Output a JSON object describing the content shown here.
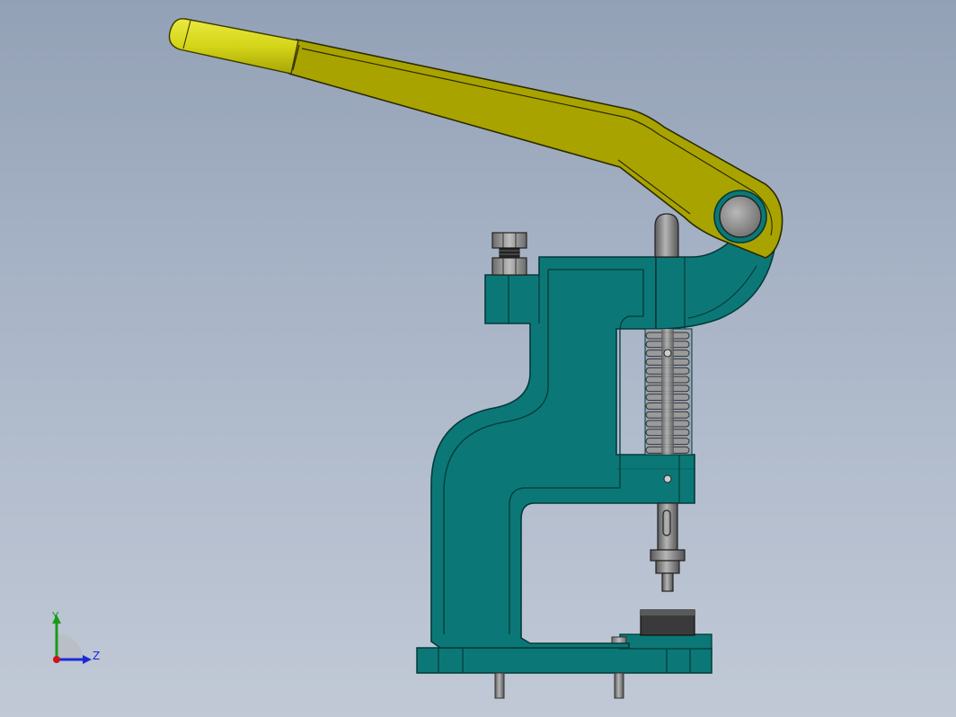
{
  "viewport": {
    "background_top": "#93a1b6",
    "background_bottom": "#c1c9d6"
  },
  "colors": {
    "frame": "#0b7877",
    "frame_edge": "#033a3a",
    "handle": "#a9a300",
    "handle_light": "#c9c410",
    "grip": "#d4d418",
    "steel": "#8c8c8c",
    "steel_dark": "#4a4a4a",
    "edge": "#1b1b1b"
  },
  "triad": {
    "y_label": "Y",
    "z_label": "Z",
    "y_color": "#1a9a1a",
    "z_color": "#1a2ad8",
    "origin_color": "#c8161a"
  },
  "parts": [
    "lever-handle",
    "handle-grip",
    "pivot-pin",
    "press-frame",
    "adjust-nut",
    "compression-spring",
    "ram-plunger",
    "punch-die",
    "anvil-die",
    "base-plate",
    "mount-bolt"
  ]
}
